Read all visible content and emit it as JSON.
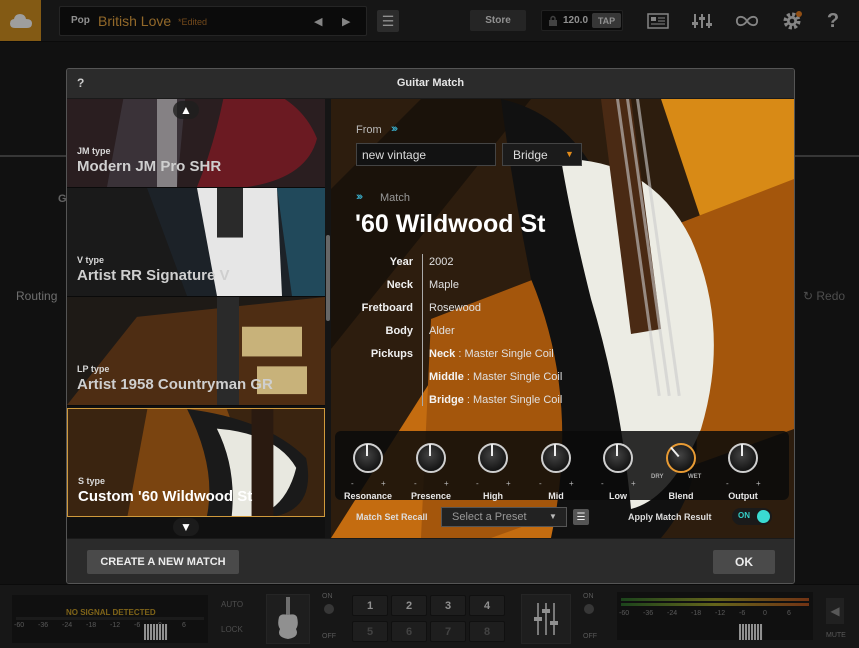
{
  "topbar": {
    "preset_category": "Pop",
    "preset_name": "British Love",
    "preset_edited": "*Edited",
    "prev_icon": "◀",
    "next_icon": "▶",
    "store_label": "Store",
    "tempo": "120.0",
    "tap_label": "TAP"
  },
  "background": {
    "routing_label": "Routing",
    "redo_label": "Redo",
    "g_label": "G"
  },
  "bottombar": {
    "no_signal": "NO SIGNAL DETECTED",
    "scale": [
      "-60",
      "-36",
      "-24",
      "-18",
      "-12",
      "-6",
      "0",
      "6"
    ],
    "auto_label": "AUTO",
    "lock_label": "LOCK",
    "on_label": "ON",
    "off_label": "OFF",
    "slots": [
      "1",
      "2",
      "3",
      "4",
      "5",
      "6",
      "7",
      "8"
    ],
    "mute_label": "MUTE"
  },
  "modal": {
    "help": "?",
    "title": "Guitar Match",
    "guitars": [
      {
        "type": "JM type",
        "name": "Modern JM Pro SHR",
        "selected": false
      },
      {
        "type": "V type",
        "name": "Artist RR Signature V",
        "selected": false
      },
      {
        "type": "LP type",
        "name": "Artist 1958 Countryman GR",
        "selected": false
      },
      {
        "type": "S type",
        "name": "Custom '60 Wildwood St",
        "selected": true
      }
    ],
    "from": {
      "label": "From",
      "input_value": "new vintage",
      "position": "Bridge"
    },
    "match": {
      "label": "Match",
      "title": "'60 Wildwood St",
      "specs": {
        "year_key": "Year",
        "year": "2002",
        "neck_key": "Neck",
        "neck": "Maple",
        "fretboard_key": "Fretboard",
        "fretboard": "Rosewood",
        "body_key": "Body",
        "body": "Alder",
        "pickups_key": "Pickups",
        "pickup_neck_pos": "Neck",
        "pickup_neck": "Master Single Coil",
        "pickup_middle_pos": "Middle",
        "pickup_middle": "Master Single Coil",
        "pickup_bridge_pos": "Bridge",
        "pickup_bridge": "Master Single Coil"
      }
    },
    "knobs": [
      {
        "label": "Resonance",
        "value": 0.5
      },
      {
        "label": "Presence",
        "value": 0.5
      },
      {
        "label": "High",
        "value": 0.5
      },
      {
        "label": "Mid",
        "value": 0.5
      },
      {
        "label": "Low",
        "value": 0.5
      },
      {
        "label": "Blend",
        "value": 0.35
      },
      {
        "label": "Output",
        "value": 0.5
      }
    ],
    "blend_dry": "DRY",
    "blend_wet": "WET",
    "match_set_recall_label": "Match Set Recall",
    "preset_select_placeholder": "Select a Preset",
    "apply_match_label": "Apply Match Result",
    "apply_match_state": "ON",
    "create_button": "CREATE A NEW MATCH",
    "ok_button": "OK"
  },
  "colors": {
    "accent_orange": "#e89b34",
    "accent_cyan": "#3fc6e8",
    "toggle_on": "#3adbd2"
  }
}
